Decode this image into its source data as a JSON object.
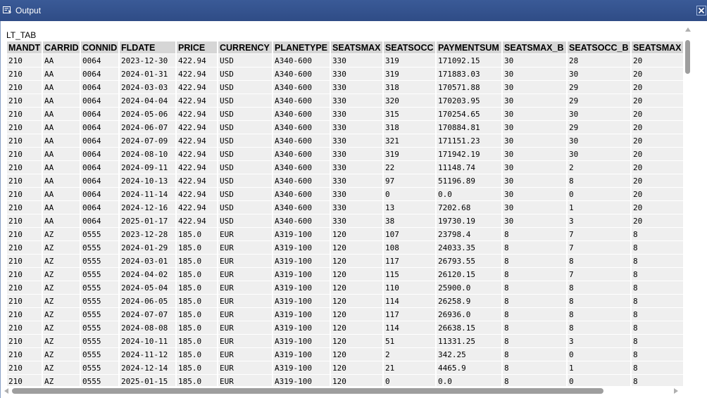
{
  "window": {
    "title": "Output",
    "table_name": "LT_TAB"
  },
  "colors": {
    "titlebar": "#2f4c86",
    "header_cell": "#d6d6d6",
    "data_cell": "#efefef",
    "scroll_thumb": "#9e9e9e"
  },
  "icons": {
    "title": "output-window-icon",
    "close": "close-x-icon"
  },
  "table": {
    "columns": [
      "MANDT",
      "CARRID",
      "CONNID",
      "FLDATE",
      "PRICE",
      "CURRENCY",
      "PLANETYPE",
      "SEATSMAX",
      "SEATSOCC",
      "PAYMENTSUM",
      "SEATSMAX_B",
      "SEATSOCC_B",
      "SEATSMAX"
    ],
    "rows": [
      [
        "210",
        "AA",
        "0064",
        "2023-12-30",
        "422.94",
        "USD",
        "A340-600",
        "330",
        "319",
        "171092.15",
        "30",
        "28",
        "20"
      ],
      [
        "210",
        "AA",
        "0064",
        "2024-01-31",
        "422.94",
        "USD",
        "A340-600",
        "330",
        "319",
        "171883.03",
        "30",
        "30",
        "20"
      ],
      [
        "210",
        "AA",
        "0064",
        "2024-03-03",
        "422.94",
        "USD",
        "A340-600",
        "330",
        "318",
        "170571.88",
        "30",
        "29",
        "20"
      ],
      [
        "210",
        "AA",
        "0064",
        "2024-04-04",
        "422.94",
        "USD",
        "A340-600",
        "330",
        "320",
        "170203.95",
        "30",
        "29",
        "20"
      ],
      [
        "210",
        "AA",
        "0064",
        "2024-05-06",
        "422.94",
        "USD",
        "A340-600",
        "330",
        "315",
        "170254.65",
        "30",
        "30",
        "20"
      ],
      [
        "210",
        "AA",
        "0064",
        "2024-06-07",
        "422.94",
        "USD",
        "A340-600",
        "330",
        "318",
        "170884.81",
        "30",
        "29",
        "20"
      ],
      [
        "210",
        "AA",
        "0064",
        "2024-07-09",
        "422.94",
        "USD",
        "A340-600",
        "330",
        "321",
        "171151.23",
        "30",
        "30",
        "20"
      ],
      [
        "210",
        "AA",
        "0064",
        "2024-08-10",
        "422.94",
        "USD",
        "A340-600",
        "330",
        "319",
        "171942.19",
        "30",
        "30",
        "20"
      ],
      [
        "210",
        "AA",
        "0064",
        "2024-09-11",
        "422.94",
        "USD",
        "A340-600",
        "330",
        "22",
        "11148.74",
        "30",
        "2",
        "20"
      ],
      [
        "210",
        "AA",
        "0064",
        "2024-10-13",
        "422.94",
        "USD",
        "A340-600",
        "330",
        "97",
        "51196.89",
        "30",
        "8",
        "20"
      ],
      [
        "210",
        "AA",
        "0064",
        "2024-11-14",
        "422.94",
        "USD",
        "A340-600",
        "330",
        "0",
        "0.0",
        "30",
        "0",
        "20"
      ],
      [
        "210",
        "AA",
        "0064",
        "2024-12-16",
        "422.94",
        "USD",
        "A340-600",
        "330",
        "13",
        "7202.68",
        "30",
        "1",
        "20"
      ],
      [
        "210",
        "AA",
        "0064",
        "2025-01-17",
        "422.94",
        "USD",
        "A340-600",
        "330",
        "38",
        "19730.19",
        "30",
        "3",
        "20"
      ],
      [
        "210",
        "AZ",
        "0555",
        "2023-12-28",
        "185.0",
        "EUR",
        "A319-100",
        "120",
        "107",
        "23798.4",
        "8",
        "7",
        "8"
      ],
      [
        "210",
        "AZ",
        "0555",
        "2024-01-29",
        "185.0",
        "EUR",
        "A319-100",
        "120",
        "108",
        "24033.35",
        "8",
        "7",
        "8"
      ],
      [
        "210",
        "AZ",
        "0555",
        "2024-03-01",
        "185.0",
        "EUR",
        "A319-100",
        "120",
        "117",
        "26793.55",
        "8",
        "8",
        "8"
      ],
      [
        "210",
        "AZ",
        "0555",
        "2024-04-02",
        "185.0",
        "EUR",
        "A319-100",
        "120",
        "115",
        "26120.15",
        "8",
        "7",
        "8"
      ],
      [
        "210",
        "AZ",
        "0555",
        "2024-05-04",
        "185.0",
        "EUR",
        "A319-100",
        "120",
        "110",
        "25900.0",
        "8",
        "8",
        "8"
      ],
      [
        "210",
        "AZ",
        "0555",
        "2024-06-05",
        "185.0",
        "EUR",
        "A319-100",
        "120",
        "114",
        "26258.9",
        "8",
        "8",
        "8"
      ],
      [
        "210",
        "AZ",
        "0555",
        "2024-07-07",
        "185.0",
        "EUR",
        "A319-100",
        "120",
        "117",
        "26936.0",
        "8",
        "8",
        "8"
      ],
      [
        "210",
        "AZ",
        "0555",
        "2024-08-08",
        "185.0",
        "EUR",
        "A319-100",
        "120",
        "114",
        "26638.15",
        "8",
        "8",
        "8"
      ],
      [
        "210",
        "AZ",
        "0555",
        "2024-10-11",
        "185.0",
        "EUR",
        "A319-100",
        "120",
        "51",
        "11331.25",
        "8",
        "3",
        "8"
      ],
      [
        "210",
        "AZ",
        "0555",
        "2024-11-12",
        "185.0",
        "EUR",
        "A319-100",
        "120",
        "2",
        "342.25",
        "8",
        "0",
        "8"
      ],
      [
        "210",
        "AZ",
        "0555",
        "2024-12-14",
        "185.0",
        "EUR",
        "A319-100",
        "120",
        "21",
        "4465.9",
        "8",
        "1",
        "8"
      ],
      [
        "210",
        "AZ",
        "0555",
        "2025-01-15",
        "185.0",
        "EUR",
        "A319-100",
        "120",
        "0",
        "0.0",
        "8",
        "0",
        "8"
      ]
    ]
  }
}
